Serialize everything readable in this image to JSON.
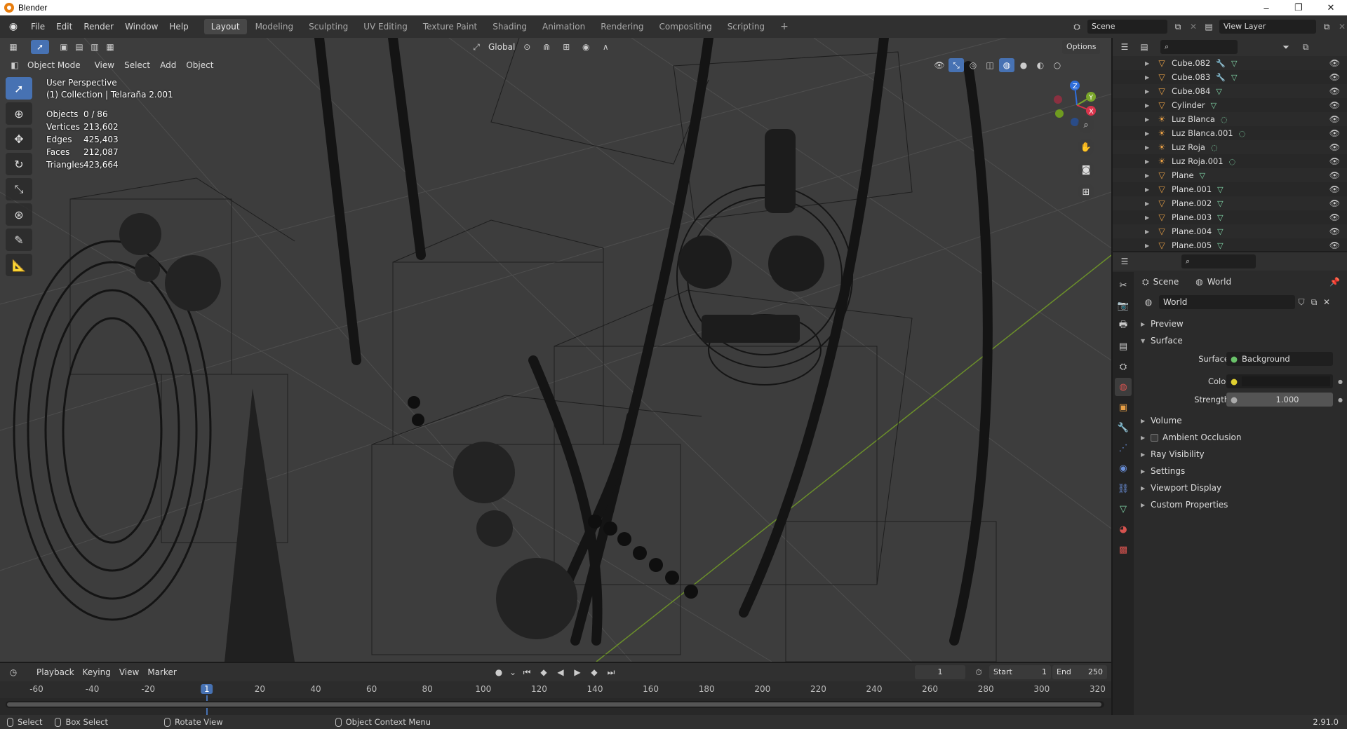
{
  "window": {
    "title": "Blender",
    "minimize": "–",
    "maximize": "❐",
    "close": "✕"
  },
  "menu": [
    "File",
    "Edit",
    "Render",
    "Window",
    "Help"
  ],
  "workspaces": [
    "Layout",
    "Modeling",
    "Sculpting",
    "UV Editing",
    "Texture Paint",
    "Shading",
    "Animation",
    "Rendering",
    "Compositing",
    "Scripting"
  ],
  "workspace_add": "+",
  "active_workspace": "Layout",
  "scene_selector": {
    "value": "Scene"
  },
  "view_layer_selector": {
    "value": "View Layer"
  },
  "viewport": {
    "mode": "Object Mode",
    "menus": [
      "View",
      "Select",
      "Add",
      "Object"
    ],
    "transform_orientation": "Global",
    "options_label": "Options",
    "perspective": "User Perspective",
    "collection_label": "(1) Collection | Telaraña 2.001",
    "stats": [
      {
        "key": "Objects",
        "value": "0 / 86"
      },
      {
        "key": "Vertices",
        "value": "213,602"
      },
      {
        "key": "Edges",
        "value": "425,403"
      },
      {
        "key": "Faces",
        "value": "212,087"
      },
      {
        "key": "Triangles",
        "value": "423,664"
      }
    ],
    "gizmo": {
      "z": "Z",
      "y": "Y",
      "x": "X"
    }
  },
  "outliner": {
    "items": [
      {
        "name": "Cube.082",
        "type": "mesh"
      },
      {
        "name": "Cube.083",
        "type": "mesh"
      },
      {
        "name": "Cube.084",
        "type": "mesh"
      },
      {
        "name": "Cylinder",
        "type": "mesh"
      },
      {
        "name": "Luz Blanca",
        "type": "light"
      },
      {
        "name": "Luz Blanca.001",
        "type": "light"
      },
      {
        "name": "Luz Roja",
        "type": "light"
      },
      {
        "name": "Luz Roja.001",
        "type": "light"
      },
      {
        "name": "Plane",
        "type": "mesh"
      },
      {
        "name": "Plane.001",
        "type": "mesh"
      },
      {
        "name": "Plane.002",
        "type": "mesh"
      },
      {
        "name": "Plane.003",
        "type": "mesh"
      },
      {
        "name": "Plane.004",
        "type": "mesh"
      },
      {
        "name": "Plane.005",
        "type": "mesh"
      }
    ]
  },
  "properties": {
    "breadcrumb_scene": "Scene",
    "breadcrumb_world": "World",
    "world_name": "World",
    "sections": {
      "preview": "Preview",
      "surface": "Surface",
      "volume": "Volume",
      "ambient_occlusion": "Ambient Occlusion",
      "ray_visibility": "Ray Visibility",
      "settings": "Settings",
      "viewport_display": "Viewport Display",
      "custom_properties": "Custom Properties"
    },
    "surface_label": "Surface",
    "surface_value": "Background",
    "color_label": "Color",
    "strength_label": "Strength",
    "strength_value": "1.000"
  },
  "timeline": {
    "menus": [
      "Playback",
      "Keying",
      "View",
      "Marker"
    ],
    "current_frame": "1",
    "start_label": "Start",
    "start_value": "1",
    "end_label": "End",
    "end_value": "250",
    "ruler_ticks": [
      "-60",
      "-40",
      "-20",
      "1",
      "20",
      "40",
      "60",
      "80",
      "100",
      "120",
      "140",
      "160",
      "180",
      "200",
      "220",
      "240",
      "260",
      "280",
      "300",
      "320"
    ]
  },
  "statusbar": {
    "select": "Select",
    "box_select": "Box Select",
    "rotate_view": "Rotate View",
    "context_menu": "Object Context Menu",
    "version": "2.91.0"
  },
  "colors": {
    "accent": "#4772b3",
    "orange": "#e8a046",
    "mesh_data": "#7fd2a5",
    "light_icon": "#e8a046"
  }
}
